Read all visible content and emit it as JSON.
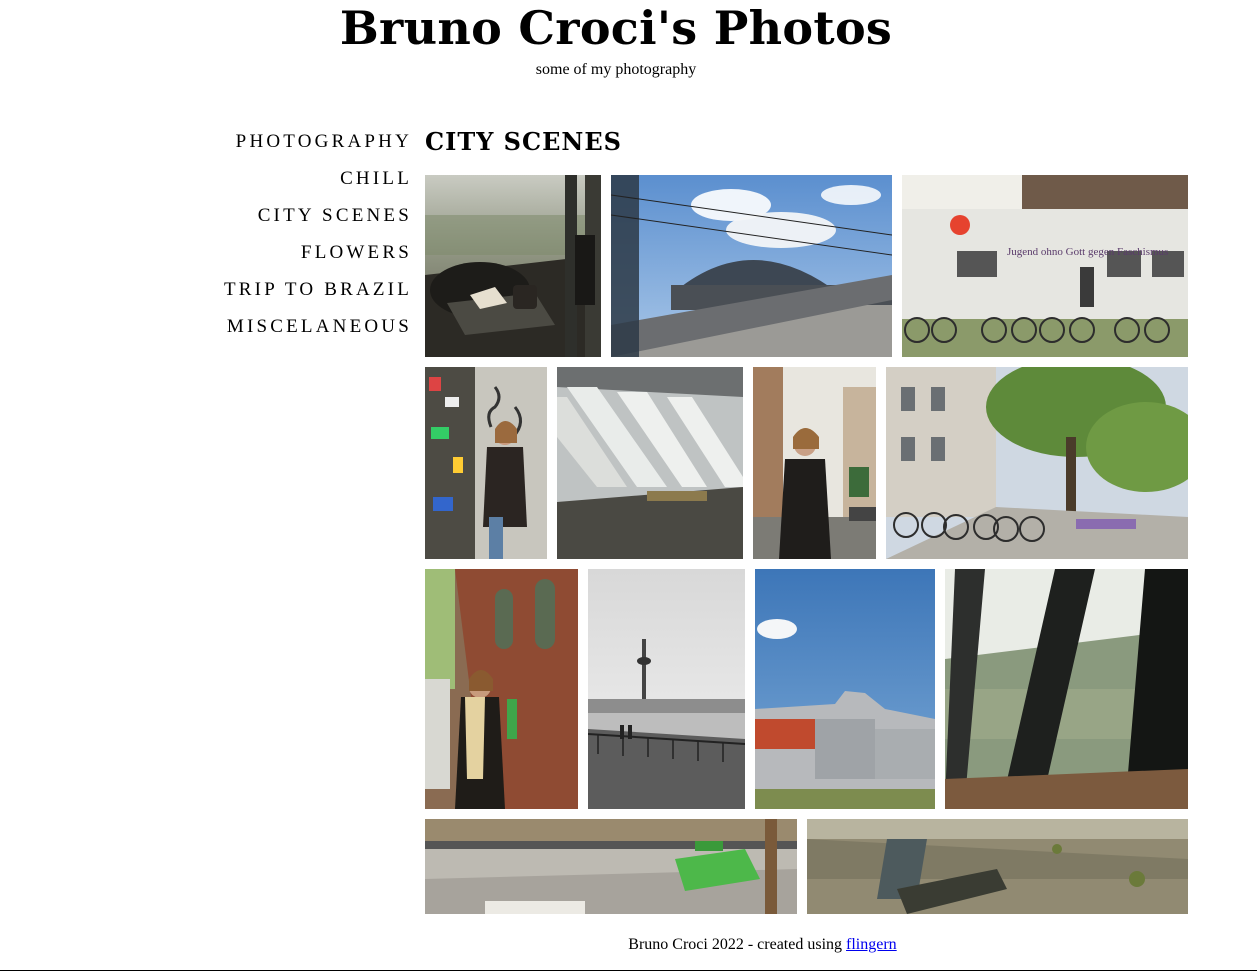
{
  "site": {
    "title": "Bruno Croci's Photos",
    "subtitle": "some of my photography"
  },
  "nav": [
    {
      "label": "PHOTOGRAPHY"
    },
    {
      "label": "CHILL"
    },
    {
      "label": "CITY SCENES"
    },
    {
      "label": "FLOWERS"
    },
    {
      "label": "TRIP TO BRAZIL"
    },
    {
      "label": "MISCELANEOUS"
    }
  ],
  "gallery": {
    "title": "CITY SCENES",
    "photos": [
      {
        "subject": "cafe table by tower window",
        "sign_text": ""
      },
      {
        "subject": "train station platform",
        "sign_text": ""
      },
      {
        "subject": "wall with bicycles and graffiti",
        "sign_text": "Jugend ohno Gott gegen Faschismus"
      },
      {
        "subject": "woman by stickered wall",
        "sign_text": ""
      },
      {
        "subject": "tilted tower windows",
        "sign_text": ""
      },
      {
        "subject": "woman on street",
        "sign_text": ""
      },
      {
        "subject": "street with bicycles and trees",
        "sign_text": ""
      },
      {
        "subject": "woman by brick building",
        "sign_text": ""
      },
      {
        "subject": "black and white tv tower",
        "sign_text": ""
      },
      {
        "subject": "museum with blue sky",
        "sign_text": ""
      },
      {
        "subject": "city view through window",
        "sign_text": ""
      },
      {
        "subject": "green container on sidewalk",
        "sign_text": ""
      },
      {
        "subject": "bench close up",
        "sign_text": ""
      }
    ]
  },
  "footer": {
    "text": "Bruno Croci 2022 - created using ",
    "link_label": "flingern"
  },
  "colors": {
    "text": "#000000",
    "link": "#0000ee",
    "background": "#ffffff"
  }
}
